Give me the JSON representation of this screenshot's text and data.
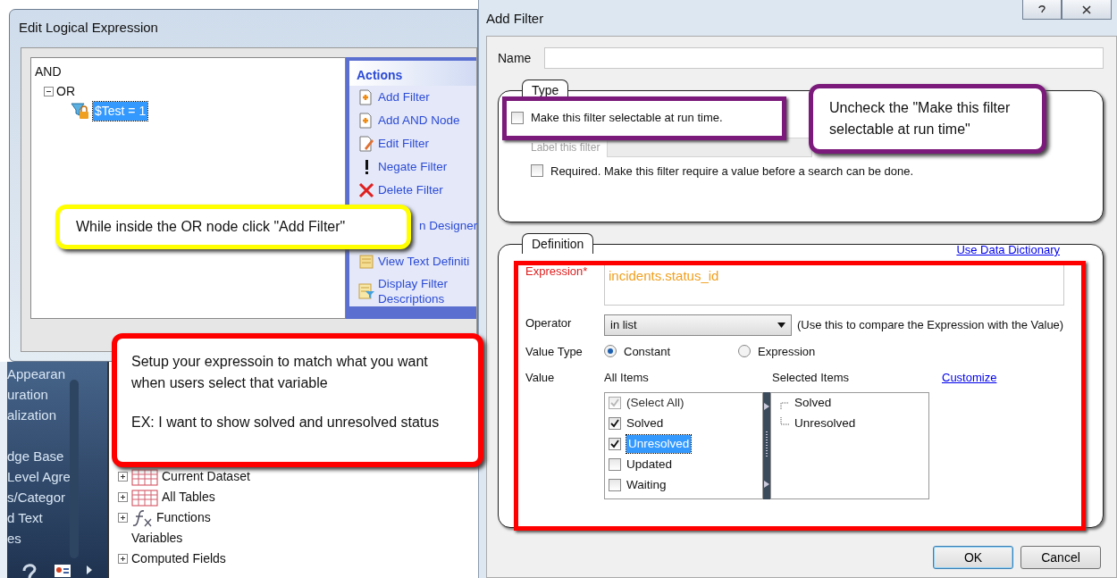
{
  "background_sidebar": {
    "items": [
      "Appearan",
      "uration",
      "alization",
      "dge Base",
      "Level Agre",
      "s/Categor",
      "d Text",
      "es"
    ]
  },
  "field_tree": {
    "items": [
      {
        "label": "Current Dataset",
        "kind": "table",
        "expanded": false
      },
      {
        "label": "All Tables",
        "kind": "table",
        "expanded": false
      },
      {
        "label": "Functions",
        "kind": "function",
        "expanded": false
      },
      {
        "label": "Variables",
        "kind": "plain"
      },
      {
        "label": "Computed Fields",
        "kind": "plain",
        "expanded": false
      }
    ]
  },
  "edit_logical_expression": {
    "title": "Edit Logical Expression",
    "tree": [
      {
        "label": "AND",
        "children": [
          {
            "label": "OR",
            "expanded": true,
            "children": [
              {
                "label": "$Test = 1",
                "selected": true
              }
            ]
          }
        ]
      }
    ],
    "actions_title": "Actions",
    "actions": [
      {
        "label": "Add Filter",
        "kind": "add"
      },
      {
        "label": "Add AND Node",
        "kind": "add"
      },
      {
        "label": "Edit Filter",
        "kind": "edit"
      },
      {
        "label": "Negate Filter",
        "kind": "negate"
      },
      {
        "label": "Delete Filter",
        "kind": "delete"
      },
      {
        "label": "n Designer",
        "kind": "covered"
      },
      {
        "label": "View Text Definiti",
        "kind": "view"
      },
      {
        "label": "Display Filter Descriptions",
        "kind": "display"
      }
    ]
  },
  "add_filter": {
    "title": "Add Filter",
    "name": {
      "label": "Name"
    },
    "type_group": {
      "title": "Type",
      "selectable": {
        "label": "Make this filter selectable at run time.",
        "checked": false
      },
      "label_field": {
        "label": "Label this filter",
        "disabled": true
      },
      "required": {
        "label": "Required. Make this filter require a value before a search can be done.",
        "checked": false
      }
    },
    "definition_group": {
      "title": "Definition",
      "dictionary_link": "Use Data Dictionary",
      "expression": {
        "label": "Expression*",
        "value": "incidents.status_id"
      },
      "operator": {
        "label": "Operator",
        "value": "in list",
        "hint": "(Use this to compare the Expression with the Value)"
      },
      "value_type": {
        "label": "Value Type",
        "options": [
          {
            "label": "Constant",
            "selected": true
          },
          {
            "label": "Expression",
            "selected": false
          }
        ]
      },
      "value": {
        "label": "Value",
        "all_items_title": "All Items",
        "selected_items_title": "Selected Items",
        "customize_link": "Customize",
        "all_items": [
          {
            "label": "(Select All)",
            "checked": true,
            "disabled": true,
            "selected": false
          },
          {
            "label": "Solved",
            "checked": true,
            "disabled": false,
            "selected": false
          },
          {
            "label": "Unresolved",
            "checked": true,
            "disabled": false,
            "selected": true
          },
          {
            "label": "Updated",
            "checked": false,
            "disabled": false,
            "selected": false
          },
          {
            "label": "Waiting",
            "checked": false,
            "disabled": false,
            "selected": false
          }
        ],
        "selected_items": [
          "Solved",
          "Unresolved"
        ]
      }
    },
    "buttons": [
      {
        "label": "OK",
        "focused": true
      },
      {
        "label": "Cancel",
        "focused": false
      }
    ]
  },
  "highlights": [
    {
      "color": "#7b1a7b"
    },
    {
      "color": "#ff0000"
    }
  ],
  "callouts": [
    {
      "paragraphs": [
        "While inside the OR node click \"Add Filter\""
      ],
      "color": "#ffff00"
    },
    {
      "paragraphs": [
        "Uncheck the \"Make this filter selectable at run time\""
      ],
      "color": "#7b1a7b"
    },
    {
      "paragraphs": [
        "Setup your expressoin to match what you want when users select that variable",
        "EX: I want to show solved and unresolved status"
      ],
      "color": "#ff0000"
    }
  ]
}
